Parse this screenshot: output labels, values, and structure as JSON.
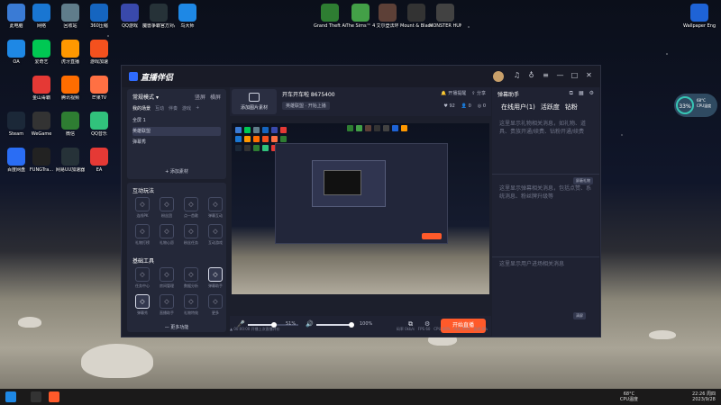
{
  "desktop": {
    "icons_col1": [
      {
        "label": "此电脑",
        "icon": "computer-icon",
        "color": "#3a7bd5"
      },
      {
        "label": "OA",
        "icon": "oa-icon",
        "color": "#1e88e5"
      },
      {
        "label": "Steam",
        "icon": "steam-icon",
        "color": "#1b2838"
      },
      {
        "label": "百度网盘",
        "icon": "baidu-netdisk-icon",
        "color": "#2a6df4"
      }
    ],
    "icons_col2": [
      {
        "label": "网络",
        "icon": "network-icon",
        "color": "#1976d2"
      },
      {
        "label": "爱奇艺",
        "icon": "iqiyi-icon",
        "color": "#00c853"
      },
      {
        "label": "金山毒霸",
        "icon": "jinshan-icon",
        "color": "#e53935"
      },
      {
        "label": "WeGame",
        "icon": "wegame-icon",
        "color": "#333"
      },
      {
        "label": "FUNGTra...",
        "icon": "fungtra-icon",
        "color": "#222"
      }
    ],
    "icons_col3": [
      {
        "label": "回收站",
        "icon": "recycle-bin-icon",
        "color": "#607d8b"
      },
      {
        "label": "虎牙直播",
        "icon": "huya-icon",
        "color": "#ff9800"
      },
      {
        "label": "腾讯视频",
        "icon": "tencent-video-icon",
        "color": "#ff6d00"
      },
      {
        "label": "微信",
        "icon": "wechat-icon",
        "color": "#2e7d32"
      },
      {
        "label": "网易UU加速器",
        "icon": "uu-icon",
        "color": "#263238"
      }
    ],
    "icons_col4": [
      {
        "label": "360压缩",
        "icon": "zip360-icon",
        "color": "#1565c0"
      },
      {
        "label": "游戏加速",
        "icon": "game-boost-icon",
        "color": "#f4511e"
      },
      {
        "label": "芒果TV",
        "icon": "mango-tv-icon",
        "color": "#ff7043"
      },
      {
        "label": "QQ音乐",
        "icon": "qq-music-icon",
        "color": "#31c27c"
      },
      {
        "label": "EA",
        "icon": "ea-icon",
        "color": "#e53935"
      }
    ],
    "icons_top": [
      {
        "label": "QQ游戏",
        "icon": "qq-game-icon",
        "color": "#3949ab"
      },
      {
        "label": "魔兽争霸官方对战平台",
        "icon": "warcraft-icon",
        "color": "#263238"
      },
      {
        "label": "鸟大师",
        "icon": "bird-icon",
        "color": "#1e88e5"
      },
      {
        "label": "Grand Theft Auto V",
        "icon": "gta-icon",
        "color": "#2e7d32"
      },
      {
        "label": "The Sims™ 4",
        "icon": "sims-icon",
        "color": "#43a047"
      },
      {
        "label": "艾尔登法环",
        "icon": "elden-icon",
        "color": "#5d4037"
      },
      {
        "label": "Mount & Blade II ...",
        "icon": "bannerlord-icon",
        "color": "#333"
      },
      {
        "label": "MONSTER HUNTER...",
        "icon": "mh-icon",
        "color": "#424242"
      },
      {
        "label": "Wallpaper Engine:...",
        "icon": "wallpaper-engine-icon",
        "color": "#1e63d6"
      }
    ]
  },
  "widget": {
    "percent": "33%",
    "line1": "68°C",
    "line2": "CPU温度"
  },
  "app": {
    "logo_text": "直播伴侣",
    "titlebar_icons": [
      "headset-icon",
      "shirt-icon",
      "menu-icon",
      "minimize-icon",
      "maximize-icon",
      "close-icon"
    ],
    "left": {
      "mode_label": "常规模式",
      "mode_tabs": [
        "竖屏",
        "横屏"
      ],
      "scene_tabs": [
        "我的场景",
        "互动",
        "伴奏",
        "游戏",
        "+"
      ],
      "scenes": [
        "全屏 1",
        "英雄联盟",
        "弹幕秀"
      ],
      "add_source": "+ 添加素材",
      "interactive_title": "互动玩法",
      "interactive_items": [
        {
          "label": "连线PK",
          "icon": "pk-icon"
        },
        {
          "label": "粉丝团",
          "icon": "fans-icon"
        },
        {
          "label": "点一首歌",
          "icon": "song-icon"
        },
        {
          "label": "弹幕互动",
          "icon": "danmu-icon"
        },
        {
          "label": "礼物打榜",
          "icon": "gift-rank-icon"
        },
        {
          "label": "礼物心愿",
          "icon": "wish-icon"
        },
        {
          "label": "粉丝任务",
          "icon": "task-icon"
        },
        {
          "label": "互动游戏",
          "icon": "game-icon"
        }
      ],
      "tools_title": "基础工具",
      "tools_items": [
        {
          "label": "任务中心",
          "icon": "task-center-icon"
        },
        {
          "label": "房间管理",
          "icon": "room-icon"
        },
        {
          "label": "数据分析",
          "icon": "data-icon"
        },
        {
          "label": "弹幕助手",
          "icon": "assistant-icon"
        },
        {
          "label": "弹幕秀",
          "icon": "show-icon"
        },
        {
          "label": "直播助手",
          "icon": "live-icon"
        },
        {
          "label": "礼物特效",
          "icon": "effect-icon"
        },
        {
          "label": "更多",
          "icon": "more-icon"
        }
      ],
      "more_label": "— 更多功能"
    },
    "center": {
      "source_btn": "添加图片素材",
      "room_title": "开车开车啦 8675400",
      "room_tag": "英雄联盟 · 开始上播",
      "top_links": [
        "开播提醒",
        "分享"
      ],
      "stats": [
        "92",
        "0",
        "0"
      ],
      "mic_value": "51%",
      "speaker_value": "100%",
      "start_button": "开始直播",
      "status_left": "▲ 00:00:00 开播上次直播评价",
      "status_right": [
        "码率 0kb/s",
        "FPS 60",
        "CPU 40%",
        "内存 55%",
        "丢帧 0%"
      ]
    },
    "right": {
      "title": "弹幕助手",
      "tabs": [
        "在线用户(1)",
        "活跃度",
        "钻粉"
      ],
      "text1": "这里显示礼物相关消息，如礼物、道具、贵族开通/续费、钻粉开通/续费",
      "text2": "这里显示弹幕相关消息，包括点赞、系统消息、粉丝牌升级等",
      "filter_btn": "屏蔽礼物",
      "text3": "这里显示用户进场相关消息",
      "clear_btn": "清屏"
    }
  },
  "taskbar": {
    "weather_temp": "68°C",
    "weather_label": "CPU温度",
    "time": "22:26 周四",
    "date": "2023/9/28"
  }
}
